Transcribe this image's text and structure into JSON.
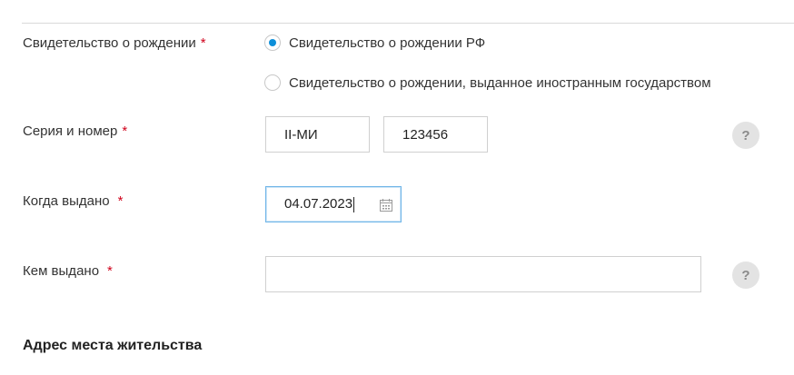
{
  "birth_cert": {
    "label": "Свидетельство о рождении",
    "required_mark": "*",
    "options": [
      {
        "label": "Свидетельство о рождении РФ",
        "selected": true
      },
      {
        "label": "Свидетельство о рождении, выданное иностранным государством",
        "selected": false
      }
    ]
  },
  "series_number": {
    "label": "Серия и номер",
    "required_mark": "*",
    "series_value": "II-МИ",
    "number_value": "123456",
    "help_icon": "?"
  },
  "issue_date": {
    "label": "Когда выдано",
    "required_mark": "*",
    "value": "04.07.2023",
    "icon": "calendar-icon"
  },
  "issued_by": {
    "label": "Кем выдано",
    "required_mark": "*",
    "value": "",
    "help_icon": "?"
  },
  "address_section": {
    "title": "Адрес места жительства"
  },
  "colors": {
    "accent": "#0d8fd9",
    "required": "#d0021b",
    "focus_border": "#6fb5e8"
  }
}
